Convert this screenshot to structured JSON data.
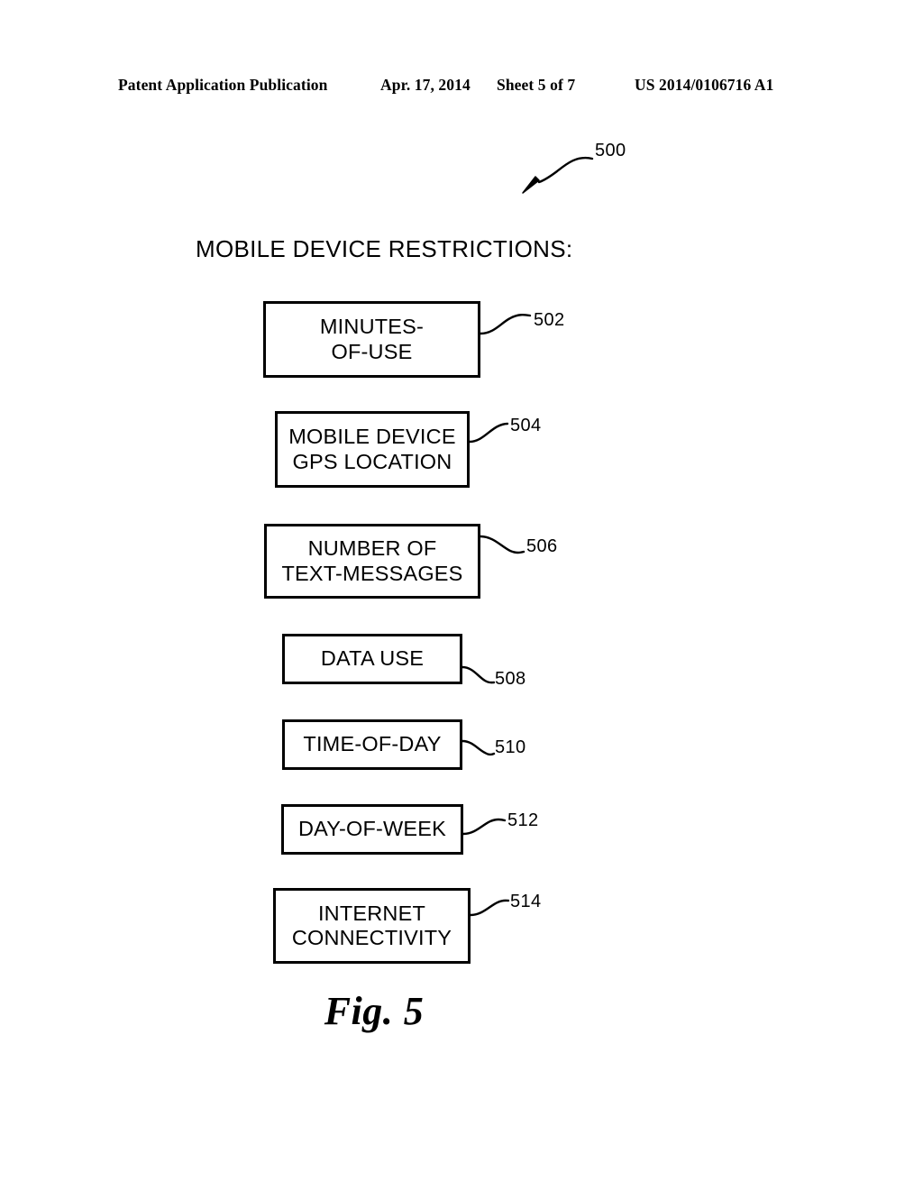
{
  "header": {
    "publication": "Patent Application Publication",
    "date": "Apr. 17, 2014",
    "sheet": "Sheet 5 of 7",
    "patent_number": "US 2014/0106716 A1"
  },
  "figure": {
    "diagram_ref": "500",
    "title": "MOBILE DEVICE RESTRICTIONS:",
    "caption": "Fig. 5",
    "boxes": [
      {
        "ref": "502",
        "line1": "MINUTES-",
        "line2": "OF-USE"
      },
      {
        "ref": "504",
        "line1": "MOBILE DEVICE",
        "line2": "GPS LOCATION"
      },
      {
        "ref": "506",
        "line1": "NUMBER OF",
        "line2": "TEXT-MESSAGES"
      },
      {
        "ref": "508",
        "line1": "DATA USE",
        "line2": ""
      },
      {
        "ref": "510",
        "line1": "TIME-OF-DAY",
        "line2": ""
      },
      {
        "ref": "512",
        "line1": "DAY-OF-WEEK",
        "line2": ""
      },
      {
        "ref": "514",
        "line1": "INTERNET",
        "line2": "CONNECTIVITY"
      }
    ]
  },
  "colors": {
    "ink": "#000000",
    "paper": "#ffffff"
  }
}
